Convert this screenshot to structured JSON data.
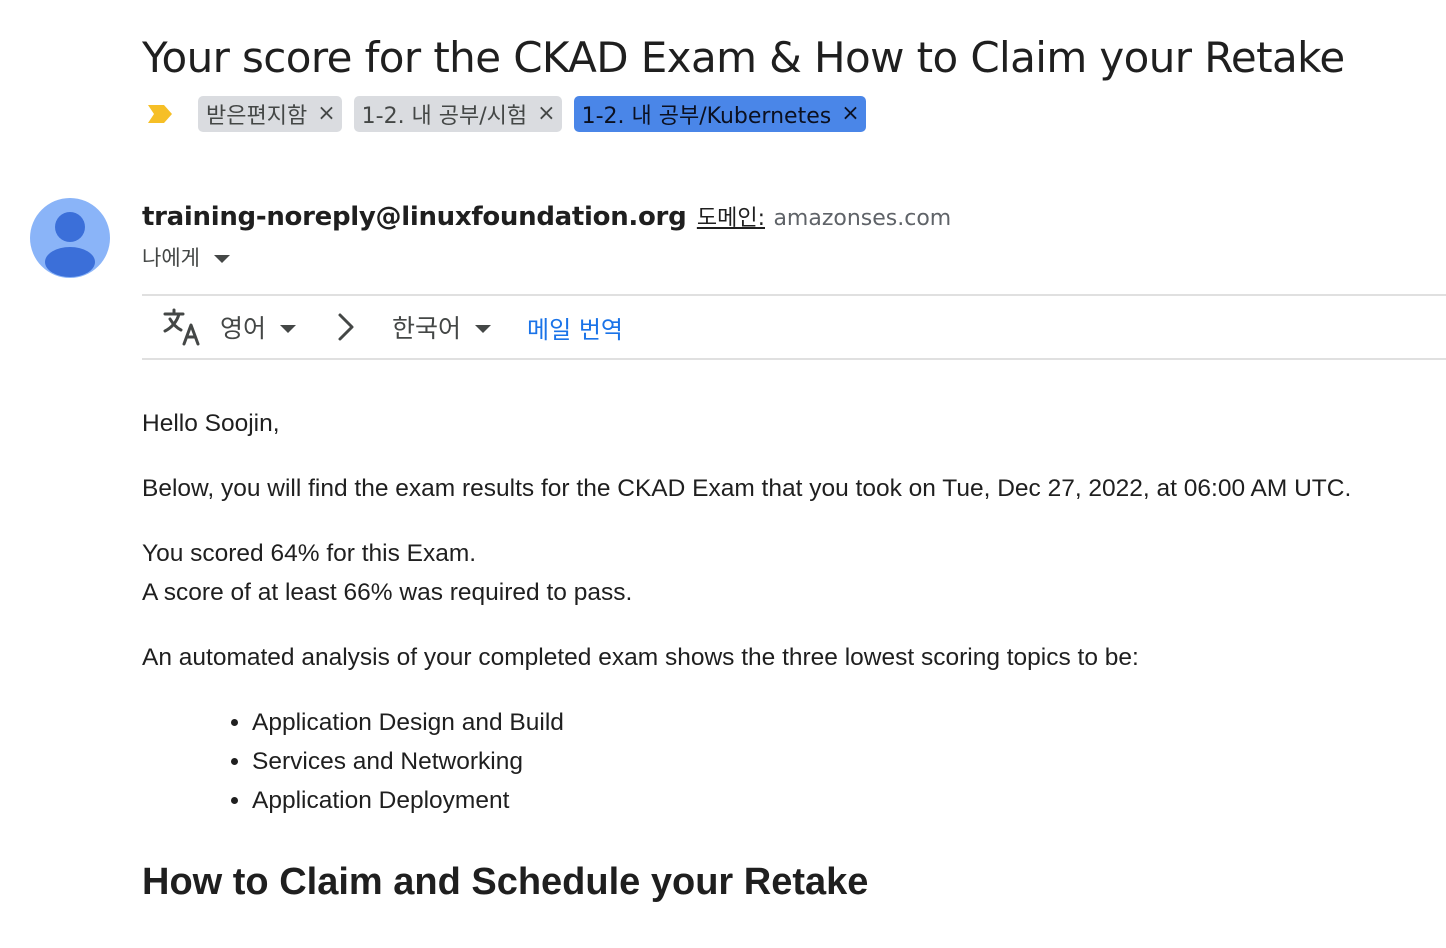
{
  "email": {
    "subject": "Your score for the CKAD Exam & How to Claim your Retake",
    "labels": [
      {
        "text": "받은편지함",
        "color": "#dadce0"
      },
      {
        "text": "1-2. 내 공부/시험",
        "color": "#dadce0"
      },
      {
        "text": "1-2. 내 공부/Kubernetes",
        "color": "#4a86e8"
      }
    ],
    "label_remove_glyph": "×",
    "importance_color": "#f6bf26",
    "sender": {
      "email": "training-noreply@linuxfoundation.org",
      "via_label": "도메인:",
      "via_domain": "amazonses.com",
      "avatar_color": "#8ab4f8"
    },
    "recipient_label": "나에게",
    "translate": {
      "from_lang": "영어",
      "to_lang": "한국어",
      "action": "메일 번역",
      "link_color": "#1a73e8"
    },
    "body": {
      "greeting": "Hello Soojin,",
      "intro": "Below, you will find the exam results for the CKAD Exam that you took on Tue, Dec 27, 2022, at 06:00 AM UTC.",
      "score_line": "You scored 64% for this Exam.",
      "required_line": "A score of at least 66% was required to pass.",
      "analysis": "An automated analysis of your completed exam shows the three lowest scoring topics to be:",
      "topics": [
        "Application Design and Build",
        "Services and Networking",
        "Application Deployment"
      ],
      "section_heading": "How to Claim and Schedule your Retake"
    }
  }
}
